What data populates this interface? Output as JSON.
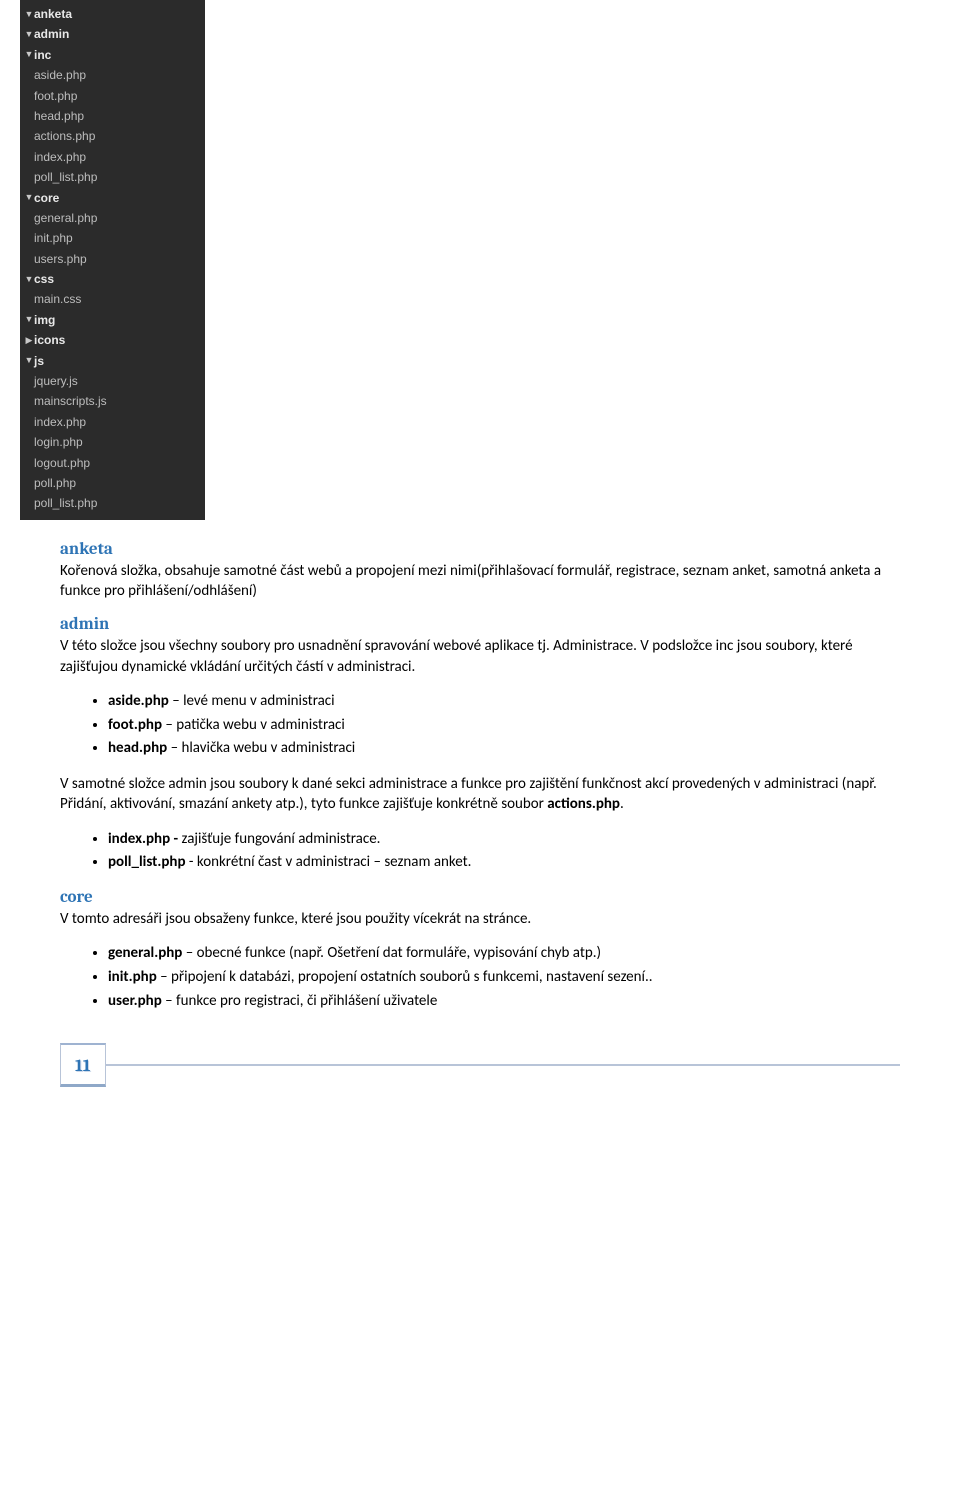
{
  "filetree": [
    {
      "indent": 0,
      "arrow": "▼",
      "style": "folder",
      "label": "anketa"
    },
    {
      "indent": 1,
      "arrow": "▼",
      "style": "folder",
      "label": "admin"
    },
    {
      "indent": 2,
      "arrow": "▼",
      "style": "folder",
      "label": "inc"
    },
    {
      "indent": 3,
      "arrow": "",
      "style": "file",
      "label": "aside.php"
    },
    {
      "indent": 3,
      "arrow": "",
      "style": "file",
      "label": "foot.php"
    },
    {
      "indent": 3,
      "arrow": "",
      "style": "file",
      "label": "head.php"
    },
    {
      "indent": 2,
      "arrow": "",
      "style": "file",
      "label": "actions.php"
    },
    {
      "indent": 2,
      "arrow": "",
      "style": "file",
      "label": "index.php"
    },
    {
      "indent": 2,
      "arrow": "",
      "style": "file",
      "label": "poll_list.php"
    },
    {
      "indent": 1,
      "arrow": "▼",
      "style": "folder",
      "label": "core"
    },
    {
      "indent": 2,
      "arrow": "",
      "style": "file",
      "label": "general.php"
    },
    {
      "indent": 2,
      "arrow": "",
      "style": "file",
      "label": "init.php"
    },
    {
      "indent": 2,
      "arrow": "",
      "style": "file",
      "label": "users.php"
    },
    {
      "indent": 1,
      "arrow": "▼",
      "style": "folder",
      "label": "css"
    },
    {
      "indent": 2,
      "arrow": "",
      "style": "file",
      "label": "main.css"
    },
    {
      "indent": 1,
      "arrow": "▼",
      "style": "folder",
      "label": "img"
    },
    {
      "indent": 2,
      "arrow": "▶",
      "style": "folder",
      "label": "icons"
    },
    {
      "indent": 1,
      "arrow": "▼",
      "style": "folder",
      "label": "js"
    },
    {
      "indent": 2,
      "arrow": "",
      "style": "file",
      "label": "jquery.js"
    },
    {
      "indent": 2,
      "arrow": "",
      "style": "file",
      "label": "mainscripts.js"
    },
    {
      "indent": 1,
      "arrow": "",
      "style": "file",
      "label": "index.php"
    },
    {
      "indent": 1,
      "arrow": "",
      "style": "file",
      "label": "login.php"
    },
    {
      "indent": 1,
      "arrow": "",
      "style": "file",
      "label": "logout.php"
    },
    {
      "indent": 1,
      "arrow": "",
      "style": "file",
      "label": "poll.php"
    },
    {
      "indent": 1,
      "arrow": "",
      "style": "file",
      "label": "poll_list.php"
    }
  ],
  "sections": {
    "anketa": {
      "title": "anketa",
      "para": "Kořenová složka, obsahuje samotné část webů a propojení mezi nimi(přihlašovací formulář, registrace, seznam anket, samotná anketa a funkce pro přihlášení/odhlášení)"
    },
    "admin": {
      "title": "admin",
      "para1": "V této složce jsou všechny soubory pro usnadnění spravování  webové aplikace tj. Administrace. V podsložce inc jsou soubory, které zajišťujou dynamické vkládání určitých částí v administraci.",
      "bullets1": [
        {
          "bold": "aside.php",
          "rest": " – levé menu v administraci"
        },
        {
          "bold": "foot.php",
          "rest": " – patička webu v administraci"
        },
        {
          "bold": "head.php",
          "rest": " – hlavička webu v administraci"
        }
      ],
      "para2_a": "V samotné složce admin jsou soubory k dané sekci administrace a funkce pro zajištění funkčnost akcí provedených v administraci (např. Přidání, aktivování, smazání ankety atp.), tyto funkce zajišťuje konkrétně soubor ",
      "para2_bold": "actions.php",
      "para2_b": ".",
      "bullets2": [
        {
          "bold": "index.php - ",
          "rest": " zajišťuje fungování administrace."
        },
        {
          "bold": "poll_list.php",
          "rest": " - konkrétní čast v administraci – seznam anket."
        }
      ]
    },
    "core": {
      "title": "core",
      "para": "V tomto adresáři jsou obsaženy funkce, které jsou použity vícekrát na stránce.",
      "bullets": [
        {
          "bold": "general.php",
          "rest": " – obecné funkce (např. Ošetření dat formuláře, vypisování chyb atp.)"
        },
        {
          "bold": "init.php",
          "rest": " – připojení k databázi, propojení ostatních souborů s funkcemi, nastavení sezení.."
        },
        {
          "bold": "user.php",
          "rest": " – funkce pro registraci, či přihlášení uživatele"
        }
      ]
    }
  },
  "pageNumber": "11"
}
